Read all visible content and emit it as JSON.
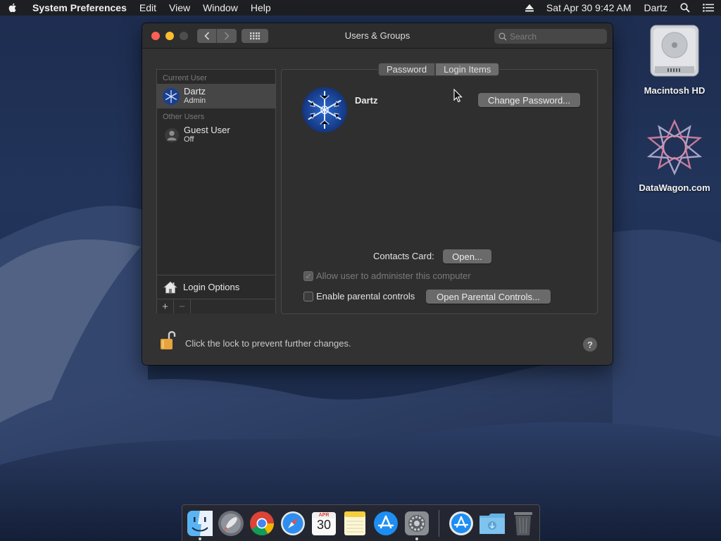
{
  "menubar": {
    "app_name": "System Preferences",
    "menus": [
      "Edit",
      "View",
      "Window",
      "Help"
    ],
    "datetime": "Sat Apr 30  9:42 AM",
    "user": "Dartz"
  },
  "window": {
    "title": "Users & Groups",
    "search_placeholder": "Search"
  },
  "sidebar": {
    "current_user_header": "Current User",
    "current_user": {
      "name": "Dartz",
      "role": "Admin"
    },
    "other_users_header": "Other Users",
    "other_users": [
      {
        "name": "Guest User",
        "status": "Off"
      }
    ],
    "login_options_label": "Login Options",
    "add_symbol": "+",
    "remove_symbol": "−"
  },
  "tabs": [
    {
      "label": "Password",
      "selected": false
    },
    {
      "label": "Login Items",
      "selected": true
    }
  ],
  "detail": {
    "username": "Dartz",
    "change_password_label": "Change Password...",
    "contacts_card_label": "Contacts Card:",
    "open_label": "Open...",
    "allow_admin_label": "Allow user to administer this computer",
    "allow_admin_checked": true,
    "allow_admin_enabled": false,
    "parental_controls_label": "Enable parental controls",
    "parental_controls_checked": false,
    "open_parental_label": "Open Parental Controls..."
  },
  "footer": {
    "lock_text": "Click the lock to prevent further changes.",
    "help_symbol": "?"
  },
  "desktop_icons": [
    {
      "label": "Macintosh HD",
      "icon": "hard-drive-icon"
    },
    {
      "label": "DataWagon.com",
      "icon": "datawagon-logo-icon"
    }
  ],
  "dock": {
    "items": [
      "finder",
      "launchpad",
      "chrome",
      "safari",
      "calendar",
      "notes",
      "app-store",
      "system-preferences",
      "app-store-downloads",
      "downloads-folder",
      "trash"
    ],
    "calendar_month": "APR",
    "calendar_day": "30"
  },
  "colors": {
    "close": "#fc5f57",
    "minimize": "#fdbc2e",
    "lock": "#e8a33c"
  }
}
